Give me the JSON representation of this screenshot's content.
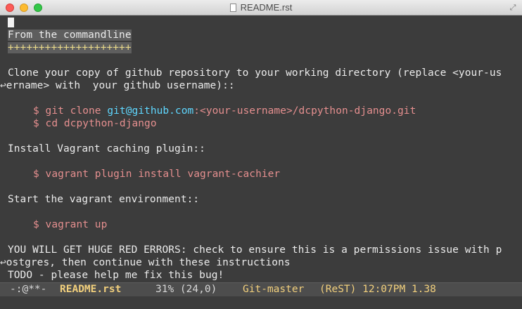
{
  "window": {
    "title": "README.rst",
    "buttons": {
      "close": "×",
      "minimize": "−",
      "maximize": "+"
    },
    "fullscreen_icon": "⤢"
  },
  "buffer": {
    "lines": [
      "From the commandline",
      "++++++++++++++++++++",
      "Clone your copy of github repository to your working directory (replace <your-us",
      "ername> with  your github username)::",
      "$ git clone ",
      "git@github.com",
      ":<your-username>/dcpython-django.git",
      "$ cd dcpython-django",
      "Install Vagrant caching plugin::",
      "$ vagrant plugin install vagrant-cachier",
      "Start the vagrant environment::",
      "$ vagrant up",
      "YOU WILL GET HUGE RED ERRORS: check to ensure this is a permissions issue with p",
      "ostgres, then continue with these instructions",
      "TODO - please help me fix this bug!"
    ],
    "continuation_glyph": "↩"
  },
  "modeline": {
    "state": "-:@**-",
    "buffer_name": "README.rst",
    "position": "31% (24,0)",
    "vcs": "Git-master",
    "mode_info": "(ReST) 12:07PM 1.38"
  },
  "colors": {
    "background": "#3c3c3c",
    "text": "#ebebeb",
    "command": "#e58f8f",
    "link": "#5fd7ff",
    "heading_underline": "#e9d98a",
    "modeline_accent": "#f1cf7c"
  }
}
